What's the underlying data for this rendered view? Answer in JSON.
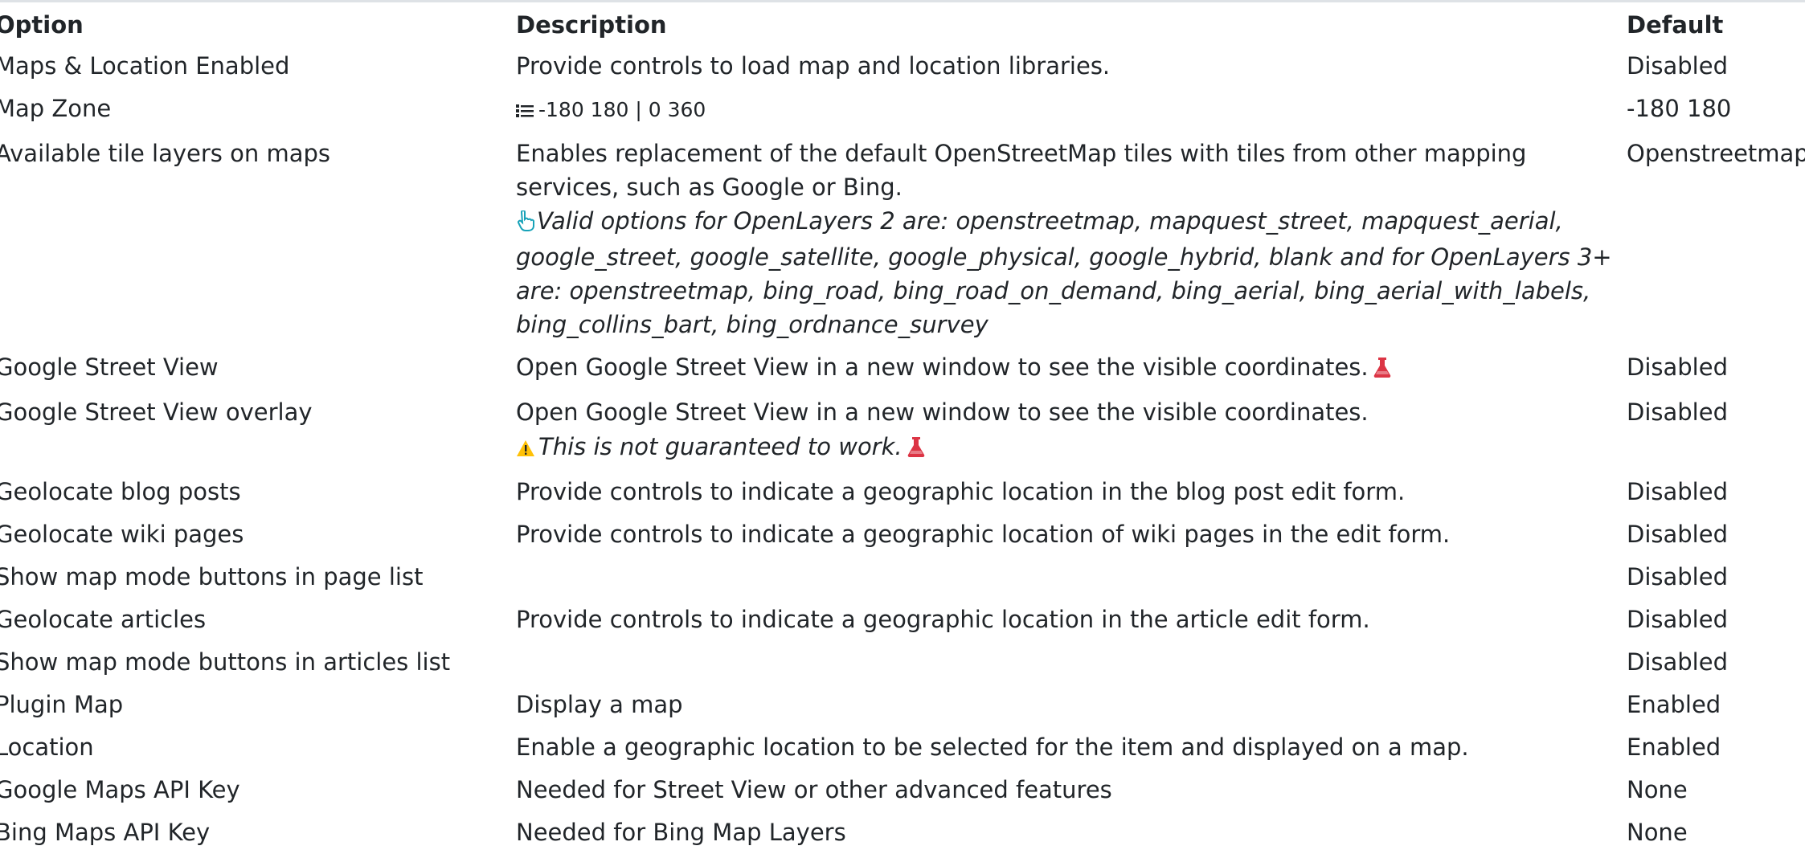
{
  "table": {
    "headers": {
      "option": "Option",
      "description": "Description",
      "default": "Default"
    },
    "rows": [
      {
        "option": "Maps & Location Enabled",
        "description": "Provide controls to load map and location libraries.",
        "default": "Disabled"
      },
      {
        "option": "Map Zone",
        "description": "-180 180 | 0 360",
        "default": "-180 180",
        "description_icon": "list-icon"
      },
      {
        "option": "Available tile layers on maps",
        "description": "Enables replacement of the default OpenStreetMap tiles with tiles from other mapping services, such as Google or Bing.",
        "note": "Valid options for OpenLayers 2 are: openstreetmap, mapquest_street, mapquest_aerial, google_street, google_satellite, google_physical, google_hybrid, blank and for OpenLayers 3+ are: openstreetmap, bing_road, bing_road_on_demand, bing_aerial, bing_aerial_with_labels, bing_collins_bart, bing_ordnance_survey",
        "note_icon": "pointing-hand-icon",
        "default": "Openstreetmap"
      },
      {
        "option": "Google Street View",
        "description": "Open Google Street View in a new window to see the visible coordinates.",
        "default": "Disabled",
        "badge_icon": "flask-icon"
      },
      {
        "option": "Google Street View overlay",
        "description": "Open Google Street View in a new window to see the visible coordinates.",
        "warning": "This is not guaranteed to work.",
        "warning_icon": "warning-icon",
        "badge_icon": "flask-icon",
        "default": "Disabled"
      },
      {
        "option": "Geolocate blog posts",
        "description": "Provide controls to indicate a geographic location in the blog post edit form.",
        "default": "Disabled"
      },
      {
        "option": "Geolocate wiki pages",
        "description": "Provide controls to indicate a geographic location of wiki pages in the edit form.",
        "default": "Disabled"
      },
      {
        "option": "Show map mode buttons in page list",
        "description": "",
        "default": "Disabled"
      },
      {
        "option": "Geolocate articles",
        "description": "Provide controls to indicate a geographic location in the article edit form.",
        "default": "Disabled"
      },
      {
        "option": "Show map mode buttons in articles list",
        "description": "",
        "default": "Disabled"
      },
      {
        "option": "Plugin Map",
        "description": "Display a map",
        "default": "Enabled"
      },
      {
        "option": "Location",
        "description": "Enable a geographic location to be selected for the item and displayed on a map.",
        "default": "Enabled"
      },
      {
        "option": "Google Maps API Key",
        "description": "Needed for Street View or other advanced features",
        "default": "None"
      },
      {
        "option": "Bing Maps API Key",
        "description": "Needed for Bing Map Layers",
        "default": "None"
      }
    ]
  },
  "colors": {
    "flask": "#dc3545",
    "warning": "#ffc107",
    "hand": "#17a2b8",
    "text": "#212529"
  }
}
